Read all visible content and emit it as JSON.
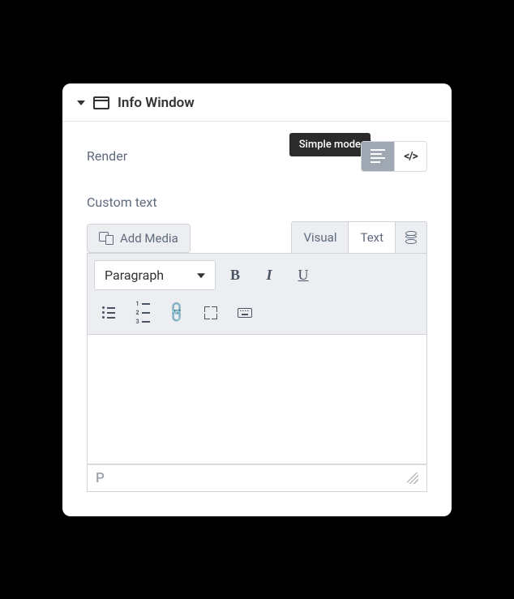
{
  "header": {
    "title": "Info Window"
  },
  "render": {
    "label": "Render",
    "tooltip": "Simple mode"
  },
  "custom_text": {
    "label": "Custom text"
  },
  "editor": {
    "add_media": "Add Media",
    "tabs": {
      "visual": "Visual",
      "text": "Text"
    },
    "format": "Paragraph",
    "buttons": {
      "bold": "B",
      "italic": "I",
      "underline": "U"
    },
    "status_path": "P"
  }
}
